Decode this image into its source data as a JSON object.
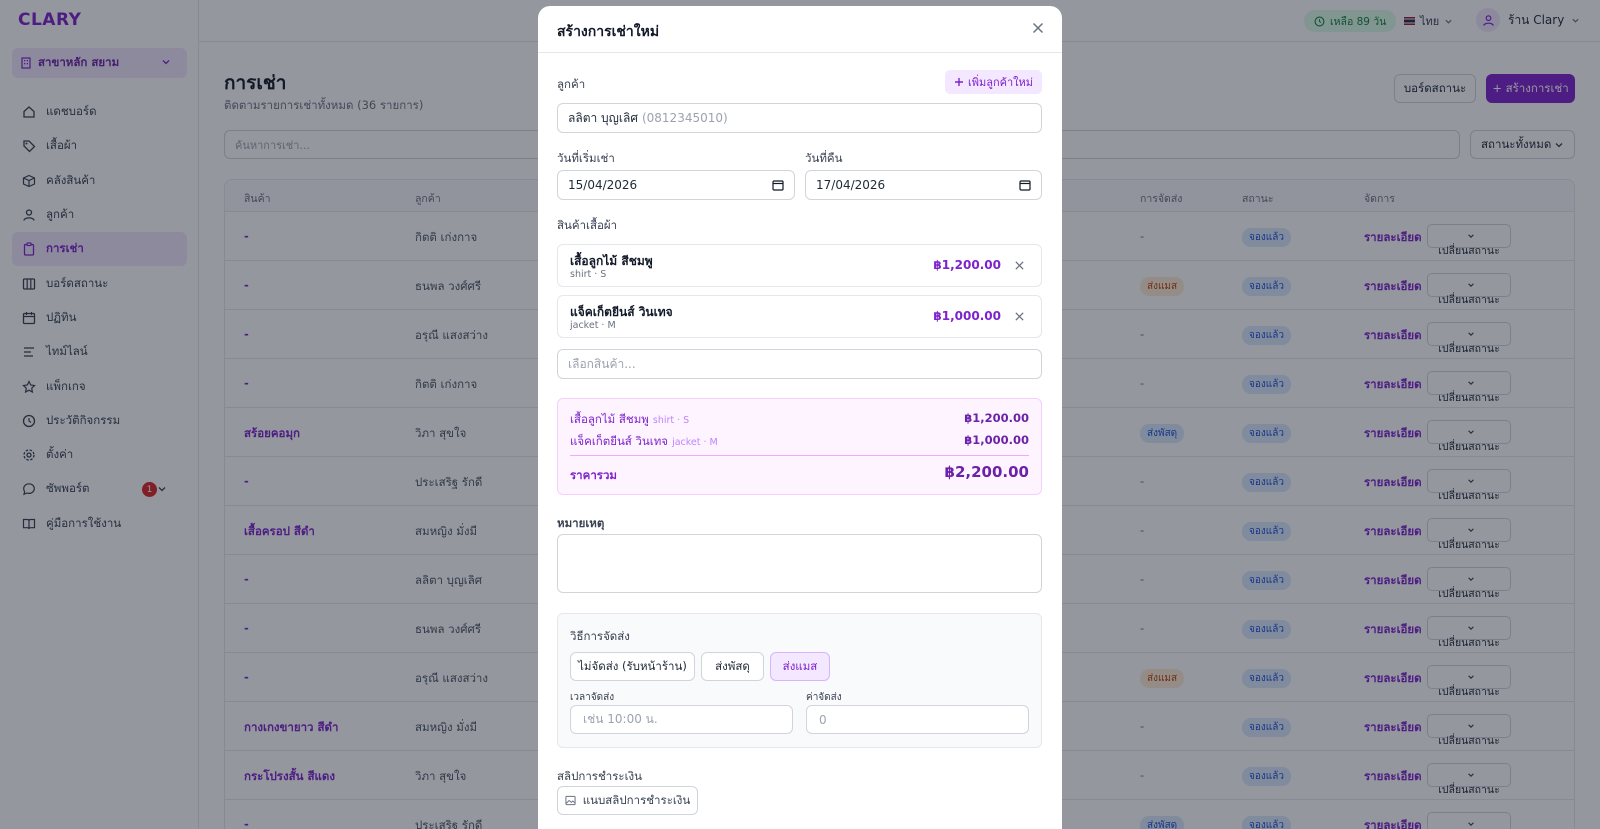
{
  "app": {
    "logo": "CLARY"
  },
  "sidebar": {
    "branch": "สาขาหลัก สยาม",
    "items": [
      {
        "label": "แดชบอร์ด",
        "icon": "home-icon"
      },
      {
        "label": "เสื้อผ้า",
        "icon": "tag-icon"
      },
      {
        "label": "คลังสินค้า",
        "icon": "box-icon"
      },
      {
        "label": "ลูกค้า",
        "icon": "users-icon"
      },
      {
        "label": "การเช่า",
        "icon": "clipboard-icon",
        "active": true
      },
      {
        "label": "บอร์ดสถานะ",
        "icon": "columns-icon"
      },
      {
        "label": "ปฏิทิน",
        "icon": "calendar-icon"
      },
      {
        "label": "ไทม์ไลน์",
        "icon": "timeline-icon"
      },
      {
        "label": "แพ็กเกจ",
        "icon": "star-icon"
      },
      {
        "label": "ประวัติกิจกรรม",
        "icon": "clock-icon"
      },
      {
        "label": "ตั้งค่า",
        "icon": "gear-icon"
      },
      {
        "label": "ซัพพอร์ต",
        "icon": "chat-icon",
        "badge": "1"
      },
      {
        "label": "คู่มือการใช้งาน",
        "icon": "book-icon"
      }
    ]
  },
  "topbar": {
    "credit": "เหลือ 89 วัน",
    "language": "ไทย",
    "user": "ร้าน Clary"
  },
  "page": {
    "title": "การเช่า",
    "subtitle": "ติดตามรายการเช่าทั้งหมด (36 รายการ)",
    "board_button": "บอร์ดสถานะ",
    "create_button": "+ สร้างการเช่า",
    "search_placeholder": "ค้นหาการเช่า...",
    "status_filter": "สถานะทั้งหมด"
  },
  "table": {
    "headers": [
      "สินค้า",
      "ลูกค้า",
      "การจัดส่ง",
      "สถานะ",
      "จัดการ"
    ],
    "detail_label": "รายละเอียด",
    "change_label": "เปลี่ยนสถานะ",
    "rows": [
      {
        "product": "-",
        "customer": "กิตติ เก่งกาจ",
        "shipping": "-",
        "status": "จองแล้ว"
      },
      {
        "product": "-",
        "customer": "ธนพล วงศ์ศรี",
        "shipping": "ส่งแมส",
        "status": "จองแล้ว"
      },
      {
        "product": "-",
        "customer": "อรุณี แสงสว่าง",
        "shipping": "-",
        "status": "จองแล้ว"
      },
      {
        "product": "-",
        "customer": "กิตติ เก่งกาจ",
        "shipping": "-",
        "status": "จองแล้ว"
      },
      {
        "product": "สร้อยคอมุก",
        "customer": "วิภา สุขใจ",
        "shipping": "ส่งพัสดุ",
        "status": "จองแล้ว"
      },
      {
        "product": "-",
        "customer": "ประเสริฐ รักดี",
        "shipping": "-",
        "status": "จองแล้ว"
      },
      {
        "product": "เสื้อครอป สีดำ",
        "customer": "สมหญิง มั่งมี",
        "shipping": "-",
        "status": "จองแล้ว"
      },
      {
        "product": "-",
        "customer": "ลลิตา บุญเลิศ",
        "shipping": "-",
        "status": "จองแล้ว"
      },
      {
        "product": "-",
        "customer": "ธนพล วงศ์ศรี",
        "shipping": "-",
        "status": "จองแล้ว"
      },
      {
        "product": "-",
        "customer": "อรุณี แสงสว่าง",
        "shipping": "ส่งแมส",
        "status": "จองแล้ว"
      },
      {
        "product": "กางเกงขายาว สีดำ",
        "customer": "สมหญิง มั่งมี",
        "shipping": "-",
        "status": "จองแล้ว"
      },
      {
        "product": "กระโปรงสั้น สีแดง",
        "customer": "วิภา สุขใจ",
        "shipping": "-",
        "status": "จองแล้ว"
      },
      {
        "product": "-",
        "customer": "ประเสริฐ รักดี",
        "shipping": "ส่งพัสดุ",
        "status": "จองแล้ว"
      }
    ]
  },
  "modal": {
    "title": "สร้างการเช่าใหม่",
    "customer_label": "ลูกค้า",
    "add_customer": "เพิ่มลูกค้าใหม่",
    "customer_name": "ลลิตา บุญเลิศ",
    "customer_phone": "(0812345010)",
    "start_label": "วันที่เริ่มเช่า",
    "start_value": "15/04/2026",
    "return_label": "วันที่คืน",
    "return_value": "17/04/2026",
    "items_label": "สินค้าเสื้อผ้า",
    "items": [
      {
        "name": "เสื้อลูกไม้ สีชมพู",
        "meta": "shirt · S",
        "price": "฿1,200.00"
      },
      {
        "name": "แจ็คเก็ตยีนส์ วินเทจ",
        "meta": "jacket · M",
        "price": "฿1,000.00"
      }
    ],
    "select_placeholder": "เลือกสินค้า...",
    "total_label": "ราคารวม",
    "total_value": "฿2,200.00",
    "note_label": "หมายเหตุ",
    "shipping_title": "วิธีการจัดส่ง",
    "shipping_options": [
      "ไม่จัดส่ง (รับหน้าร้าน)",
      "ส่งพัสดุ",
      "ส่งแมส"
    ],
    "shipping_selected": "ส่งแมส",
    "ship_time_label": "เวลาจัดส่ง",
    "ship_time_placeholder": "เช่น 10:00 น.",
    "ship_cost_label": "ค่าจัดส่ง",
    "ship_cost_placeholder": "0",
    "slip_label": "สลิปการชำระเงิน",
    "slip_button": "แนบสลิปการชำระเงิน"
  },
  "colors": {
    "accent": "#7e22ce",
    "accent_light": "#f3e8ff",
    "badge_blue": "#dbeafe",
    "badge_orange": "#ffedd5"
  }
}
